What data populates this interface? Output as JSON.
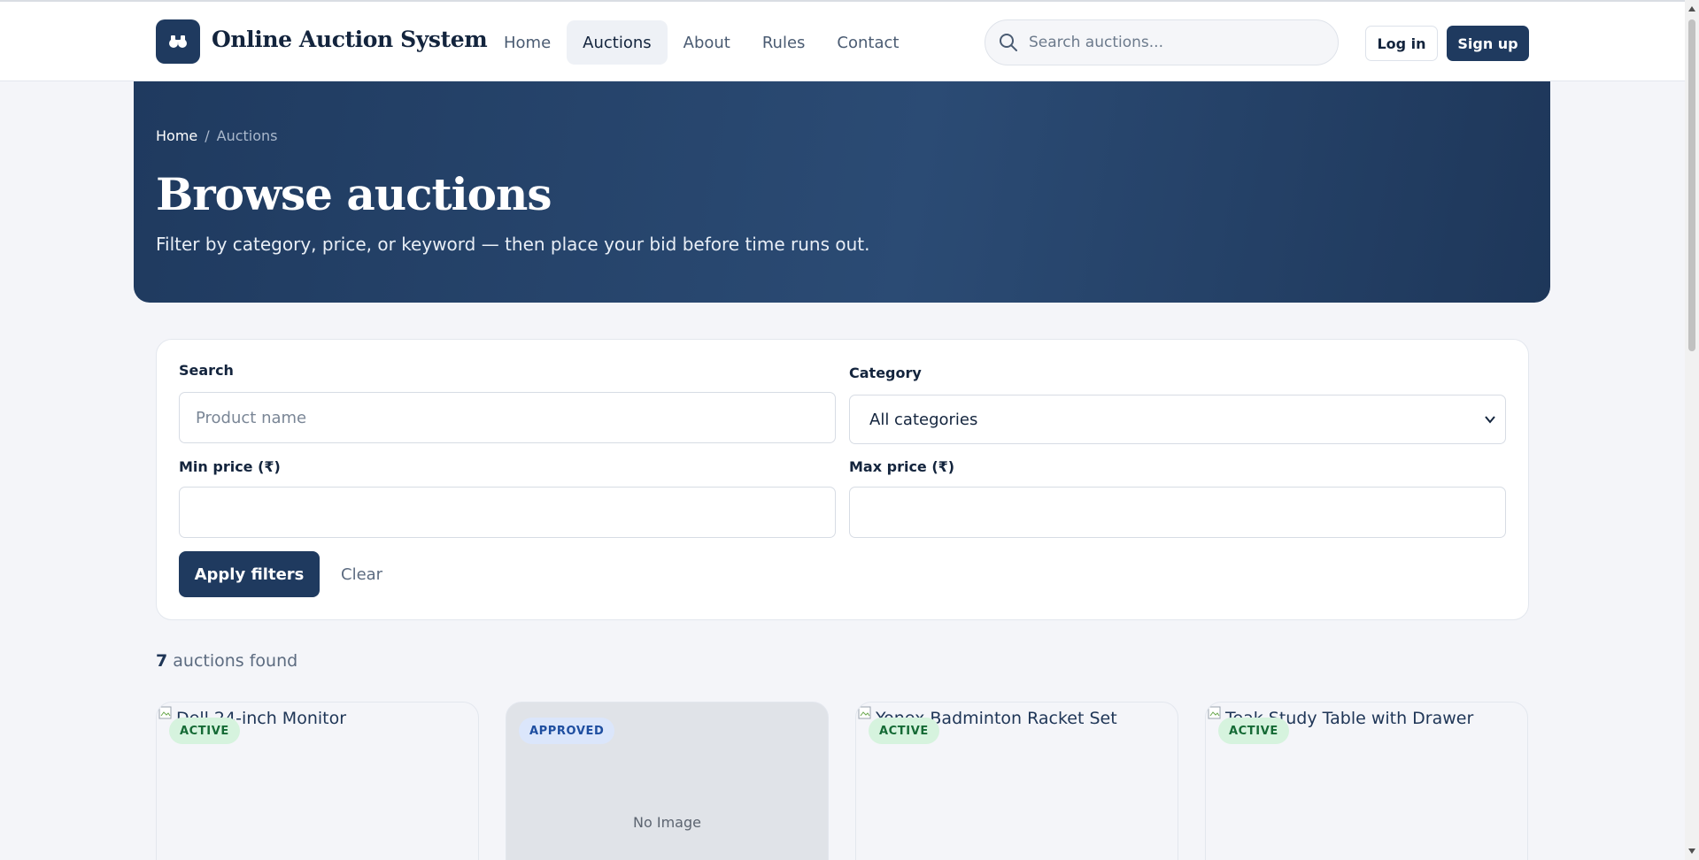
{
  "header": {
    "brand": "Online Auction System",
    "nav": [
      {
        "label": "Home"
      },
      {
        "label": "Auctions"
      },
      {
        "label": "About"
      },
      {
        "label": "Rules"
      },
      {
        "label": "Contact"
      }
    ],
    "active_nav": "Auctions",
    "search_placeholder": "Search auctions...",
    "login_label": "Log in",
    "signup_label": "Sign up"
  },
  "hero": {
    "breadcrumb_home": "Home",
    "breadcrumb_sep": "/",
    "breadcrumb_current": "Auctions",
    "title": "Browse auctions",
    "subtitle": "Filter by category, price, or keyword — then place your bid before time runs out."
  },
  "filters": {
    "search_label": "Search",
    "search_placeholder": "Product name",
    "category_label": "Category",
    "category_value": "All categories",
    "min_price_label": "Min price (₹)",
    "max_price_label": "Max price (₹)",
    "apply_label": "Apply filters",
    "clear_label": "Clear"
  },
  "results": {
    "count": "7",
    "suffix": " auctions found"
  },
  "cards": [
    {
      "alt": "Dell 24-inch Monitor",
      "badge": "ACTIVE",
      "has_image": true
    },
    {
      "alt": "",
      "badge": "APPROVED",
      "has_image": false,
      "no_image_text": "No Image"
    },
    {
      "alt": "Yonex Badminton Racket Set",
      "badge": "ACTIVE",
      "has_image": true
    },
    {
      "alt": "Teak Study Table with Drawer",
      "badge": "ACTIVE",
      "has_image": true
    }
  ],
  "colors": {
    "primary": "#1f3a5f",
    "page_bg": "#f4f5f9",
    "active_badge_bg": "#d6f3de",
    "approved_badge_bg": "#dbe6fb"
  },
  "icons": [
    "gavel-icon",
    "search-icon",
    "chevron-down-icon",
    "broken-image-icon"
  ]
}
